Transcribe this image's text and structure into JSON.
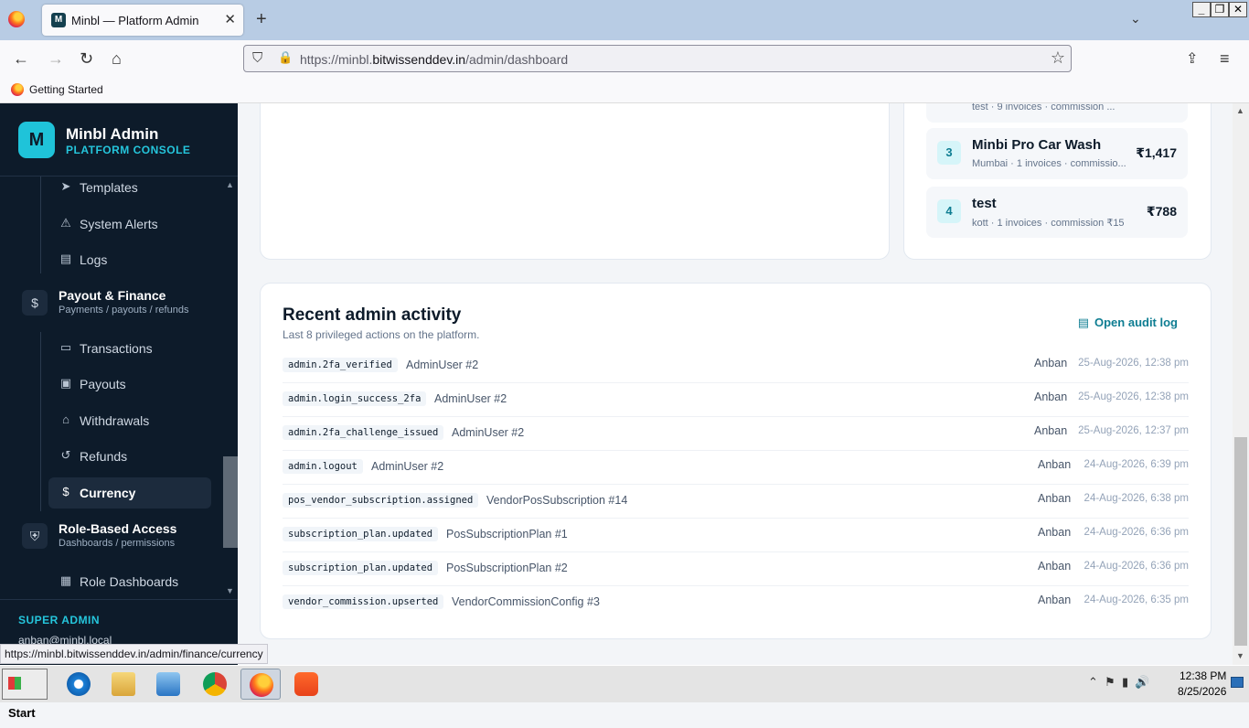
{
  "browser": {
    "tab_title": "Minbl — Platform Admin",
    "tab_favicon_letter": "M",
    "url_prefix": "https://minbl.",
    "url_domain": "bitwissenddev.in",
    "url_path": "/admin/dashboard",
    "bookmark": "Getting Started",
    "status_url": "https://minbl.bitwissenddev.in/admin/finance/currency"
  },
  "sidebar": {
    "brand_letter": "M",
    "brand_name": "Minbl Admin",
    "brand_sub": "PLATFORM CONSOLE",
    "items_top": [
      {
        "label": "Templates",
        "icon": "send-icon"
      },
      {
        "label": "System Alerts",
        "icon": "alert-icon"
      },
      {
        "label": "Logs",
        "icon": "log-icon"
      }
    ],
    "group_finance": {
      "title": "Payout & Finance",
      "sub": "Payments / payouts / refunds",
      "icon": "dollar-circle-icon"
    },
    "items_finance": [
      {
        "label": "Transactions",
        "icon": "card-icon"
      },
      {
        "label": "Payouts",
        "icon": "payout-icon"
      },
      {
        "label": "Withdrawals",
        "icon": "bank-icon"
      },
      {
        "label": "Refunds",
        "icon": "refund-icon"
      },
      {
        "label": "Currency",
        "icon": "currency-icon",
        "active": true
      }
    ],
    "group_access": {
      "title": "Role-Based Access",
      "sub": "Dashboards / permissions",
      "icon": "shield-icon"
    },
    "items_access": [
      {
        "label": "Role Dashboards",
        "icon": "grid-icon"
      }
    ],
    "role": "SUPER ADMIN",
    "email": "anban@minbl.local"
  },
  "top_vendors": [
    {
      "rank": "",
      "name": "",
      "meta": "test · 9 invoices · commission ...",
      "amount": ""
    },
    {
      "rank": "3",
      "name": "Minbi Pro Car Wash",
      "meta": "Mumbai · 1 invoices · commissio...",
      "amount": "₹1,417"
    },
    {
      "rank": "4",
      "name": "test",
      "meta": "kott · 1 invoices · commission ₹15",
      "amount": "₹788"
    }
  ],
  "activity": {
    "title": "Recent admin activity",
    "subtitle": "Last 8 privileged actions on the platform.",
    "audit_link": "Open audit log",
    "rows": [
      {
        "action": "admin.2fa_verified",
        "target": "AdminUser #2",
        "actor": "Anban",
        "time": "25-Aug-2026, 12:38 pm"
      },
      {
        "action": "admin.login_success_2fa",
        "target": "AdminUser #2",
        "actor": "Anban",
        "time": "25-Aug-2026, 12:38 pm"
      },
      {
        "action": "admin.2fa_challenge_issued",
        "target": "AdminUser #2",
        "actor": "Anban",
        "time": "25-Aug-2026, 12:37 pm"
      },
      {
        "action": "admin.logout",
        "target": "AdminUser #2",
        "actor": "Anban",
        "time": "24-Aug-2026, 6:39 pm"
      },
      {
        "action": "pos_vendor_subscription.assigned",
        "target": "VendorPosSubscription #14",
        "actor": "Anban",
        "time": "24-Aug-2026, 6:38 pm"
      },
      {
        "action": "subscription_plan.updated",
        "target": "PosSubscriptionPlan #1",
        "actor": "Anban",
        "time": "24-Aug-2026, 6:36 pm"
      },
      {
        "action": "subscription_plan.updated",
        "target": "PosSubscriptionPlan #2",
        "actor": "Anban",
        "time": "24-Aug-2026, 6:36 pm"
      },
      {
        "action": "vendor_commission.upserted",
        "target": "VendorCommissionConfig #3",
        "actor": "Anban",
        "time": "24-Aug-2026, 6:35 pm"
      }
    ]
  },
  "taskbar": {
    "start": "Start",
    "time": "12:38 PM",
    "date": "8/25/2026"
  },
  "colors": {
    "accent": "#25c6dc",
    "sidebar_bg": "#0d1b2a",
    "link": "#0e7d92"
  }
}
